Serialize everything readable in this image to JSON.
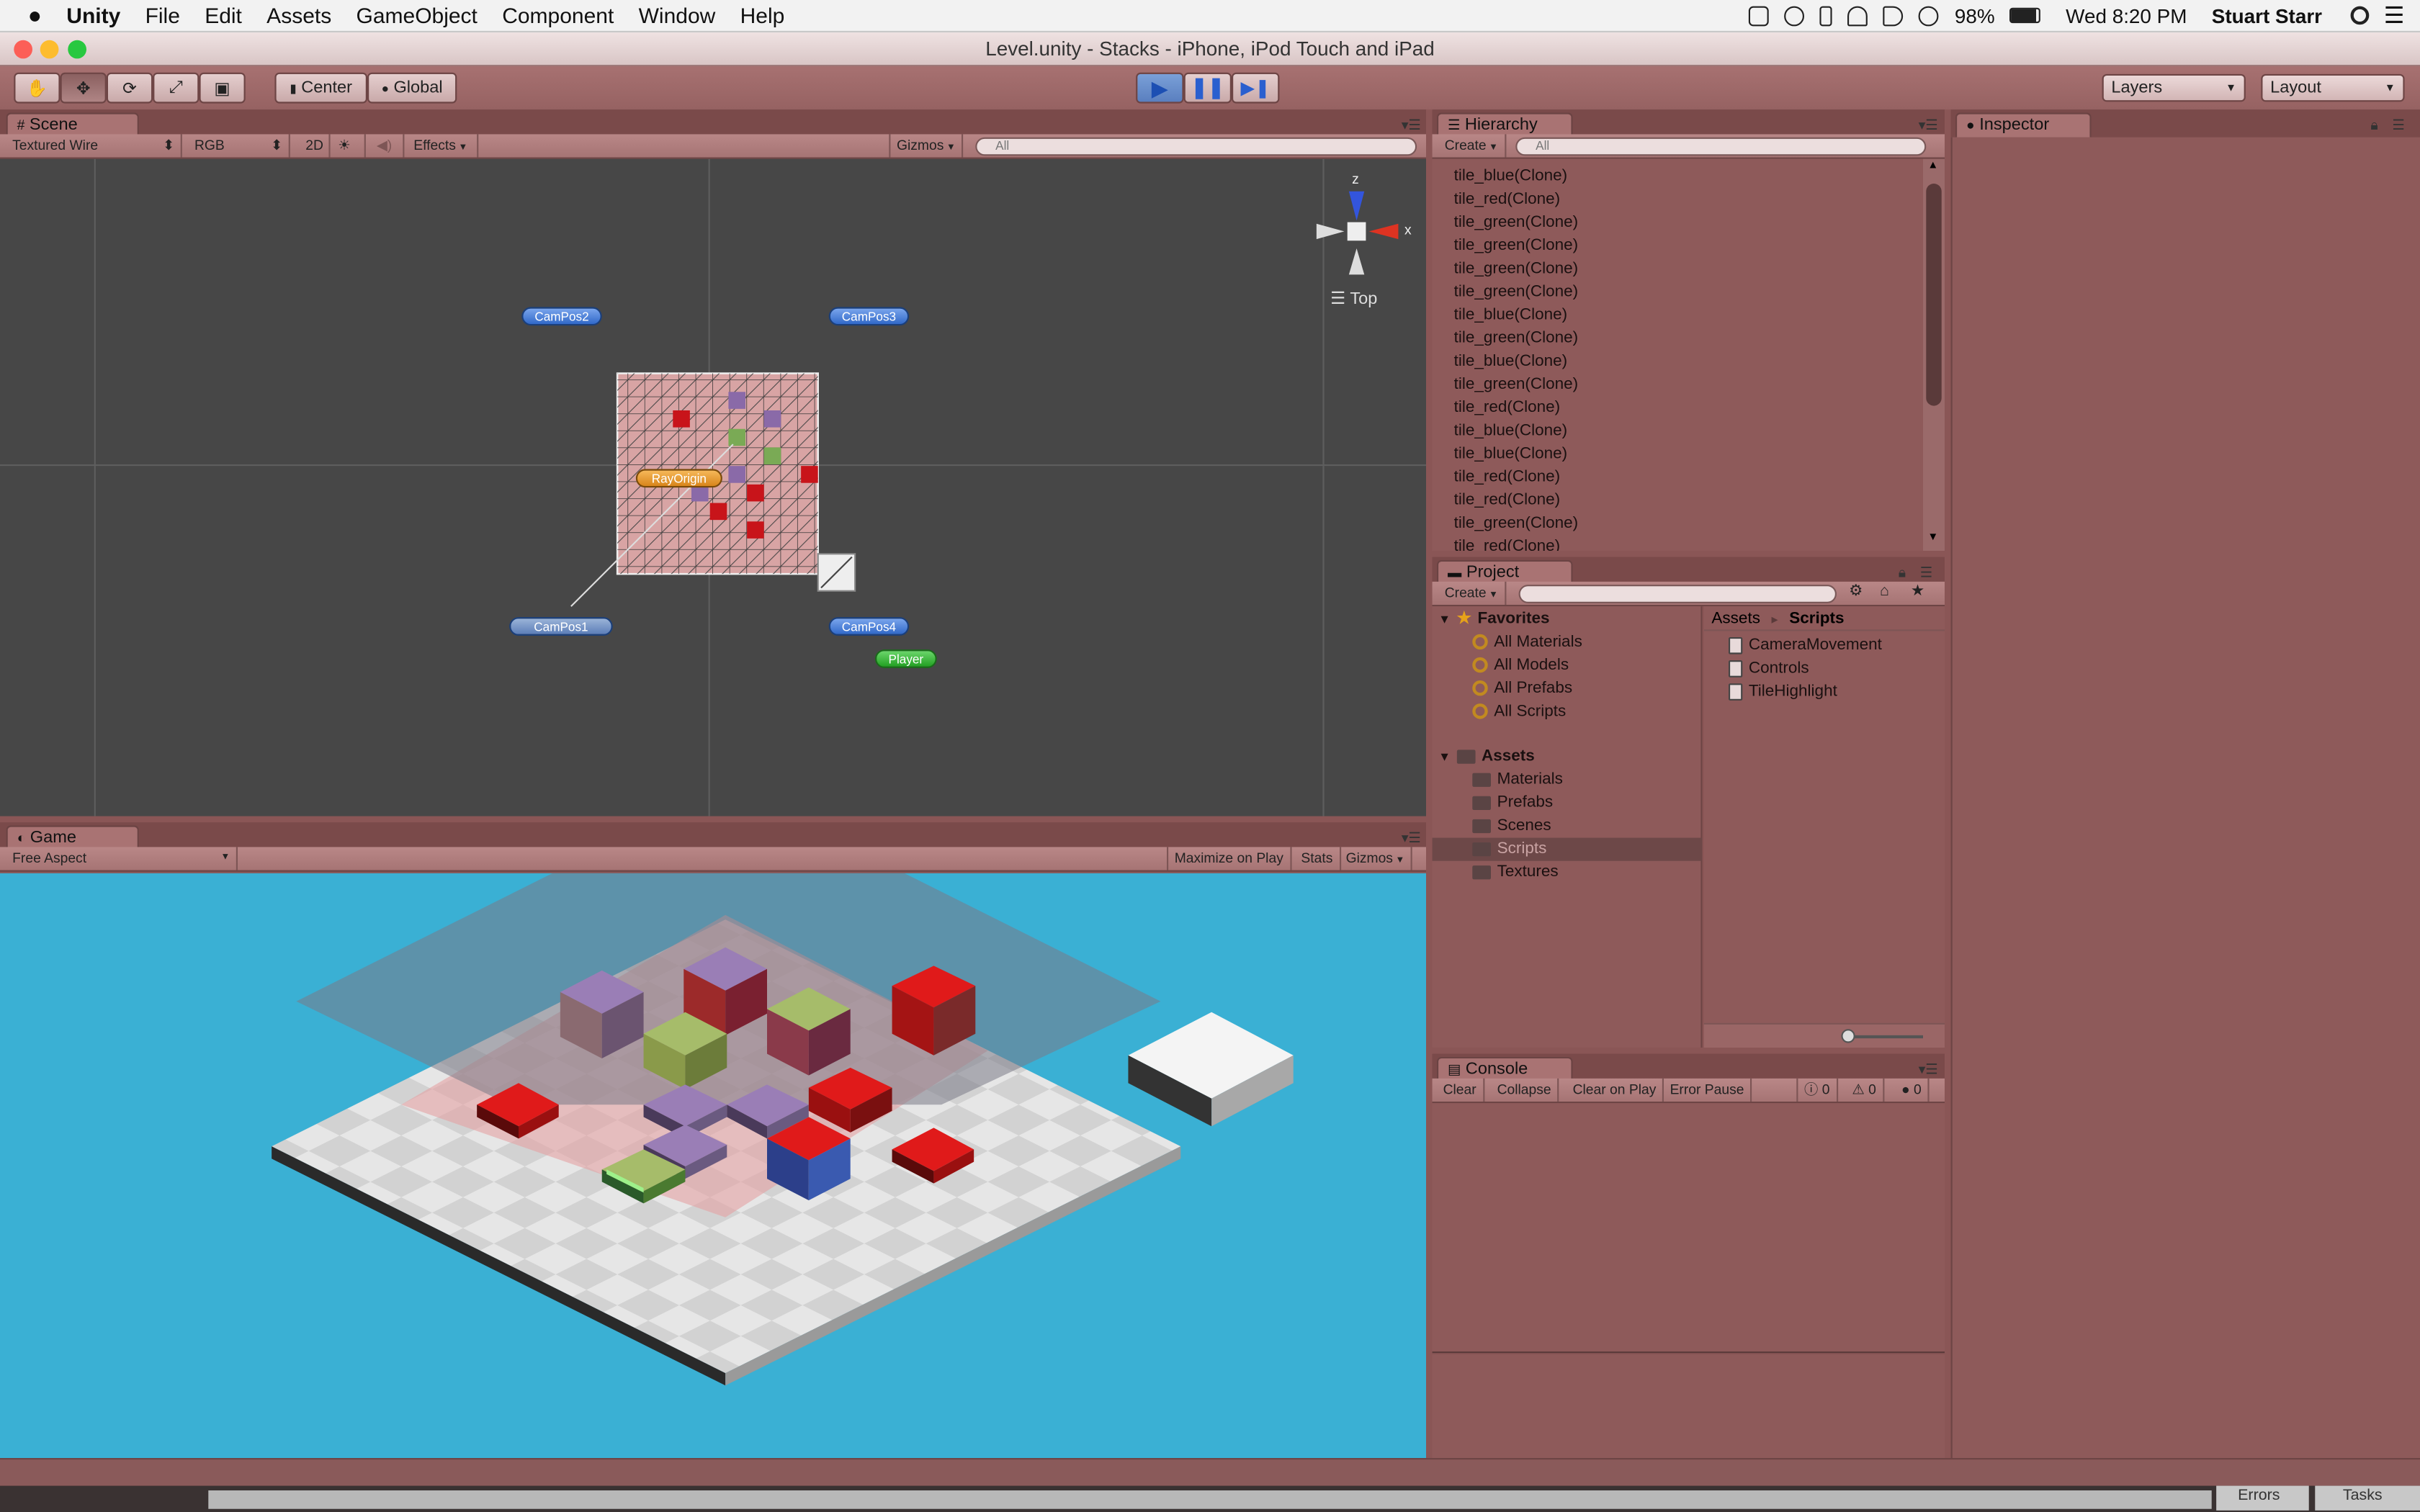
{
  "menubar": {
    "apple": "",
    "app": "Unity",
    "items": [
      "File",
      "Edit",
      "Assets",
      "GameObject",
      "Component",
      "Window",
      "Help"
    ],
    "battery": "98%",
    "clock": "Wed 8:20 PM",
    "user": "Stuart Starr"
  },
  "window": {
    "title": "Level.unity - Stacks - iPhone, iPod Touch and iPad"
  },
  "toolbar": {
    "pivot": "Center",
    "space": "Global",
    "layers": "Layers",
    "layout": "Layout"
  },
  "scene": {
    "tab": "Scene",
    "draw_mode": "Textured Wire",
    "color": "RGB",
    "mode2d": "2D",
    "effects": "Effects",
    "gizmos": "Gizmos",
    "search_placeholder": "All",
    "gizmo_label": "Top",
    "axis_z": "z",
    "axis_x": "x",
    "labels": {
      "campos1": "CamPos1",
      "campos2": "CamPos2",
      "campos3": "CamPos3",
      "campos4": "CamPos4",
      "rayorigin": "RayOrigin",
      "player": "Player"
    }
  },
  "game": {
    "tab": "Game",
    "aspect": "Free Aspect",
    "maximize": "Maximize on Play",
    "stats": "Stats",
    "gizmos": "Gizmos"
  },
  "hierarchy": {
    "tab": "Hierarchy",
    "create": "Create",
    "search_placeholder": "All",
    "items": [
      "tile_blue(Clone)",
      "tile_red(Clone)",
      "tile_green(Clone)",
      "tile_green(Clone)",
      "tile_green(Clone)",
      "tile_green(Clone)",
      "tile_blue(Clone)",
      "tile_green(Clone)",
      "tile_blue(Clone)",
      "tile_green(Clone)",
      "tile_red(Clone)",
      "tile_blue(Clone)",
      "tile_blue(Clone)",
      "tile_red(Clone)",
      "tile_red(Clone)",
      "tile_green(Clone)",
      "tile_red(Clone)"
    ]
  },
  "inspector": {
    "tab": "Inspector"
  },
  "project": {
    "tab": "Project",
    "create": "Create",
    "favorites": "Favorites",
    "fav_items": [
      "All Materials",
      "All Models",
      "All Prefabs",
      "All Scripts"
    ],
    "assets": "Assets",
    "asset_folders": [
      "Materials",
      "Prefabs",
      "Scenes",
      "Scripts",
      "Textures"
    ],
    "breadcrumb_root": "Assets",
    "breadcrumb_sep": "►",
    "breadcrumb_current": "Scripts",
    "scripts": [
      "CameraMovement",
      "Controls",
      "TileHighlight"
    ]
  },
  "console": {
    "tab": "Console",
    "buttons": [
      "Clear",
      "Collapse",
      "Clear on Play",
      "Error Pause"
    ],
    "info_count": "0",
    "warn_count": "0",
    "error_count": "0"
  },
  "dock": {
    "errors": "Errors",
    "tasks": "Tasks"
  }
}
